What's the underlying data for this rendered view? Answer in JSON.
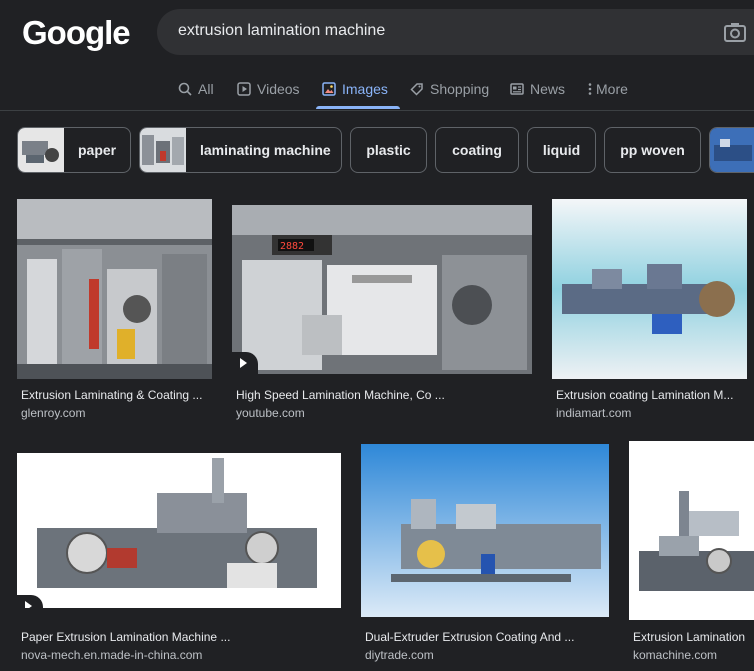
{
  "logo": "Google",
  "search": {
    "query": "extrusion lamination machine"
  },
  "tabs": [
    {
      "label": "All",
      "icon": "search-icon"
    },
    {
      "label": "Videos",
      "icon": "video-icon"
    },
    {
      "label": "Images",
      "icon": "image-icon",
      "active": true
    },
    {
      "label": "Shopping",
      "icon": "tag-icon"
    },
    {
      "label": "News",
      "icon": "news-icon"
    },
    {
      "label": "More",
      "icon": "more-vert-icon"
    }
  ],
  "chips": [
    {
      "label": "paper"
    },
    {
      "label": "laminating machine"
    },
    {
      "label": "plastic"
    },
    {
      "label": "coating"
    },
    {
      "label": "liquid"
    },
    {
      "label": "pp woven"
    }
  ],
  "results": [
    {
      "title": "Extrusion Laminating & Coating ...",
      "source": "glenroy.com"
    },
    {
      "title": "High Speed Lamination Machine, Co ...",
      "source": "youtube.com",
      "video": true
    },
    {
      "title": "Extrusion coating Lamination M...",
      "source": "indiamart.com"
    },
    {
      "title": "Paper Extrusion Lamination Machine ...",
      "source": "nova-mech.en.made-in-china.com",
      "video": true
    },
    {
      "title": "Dual-Extruder Extrusion Coating And ...",
      "source": "diytrade.com"
    },
    {
      "title": "Extrusion Lamination",
      "source": "komachine.com"
    }
  ],
  "colors": {
    "background": "#202124",
    "accent": "#8ab4f8",
    "search_bg": "#303134"
  }
}
